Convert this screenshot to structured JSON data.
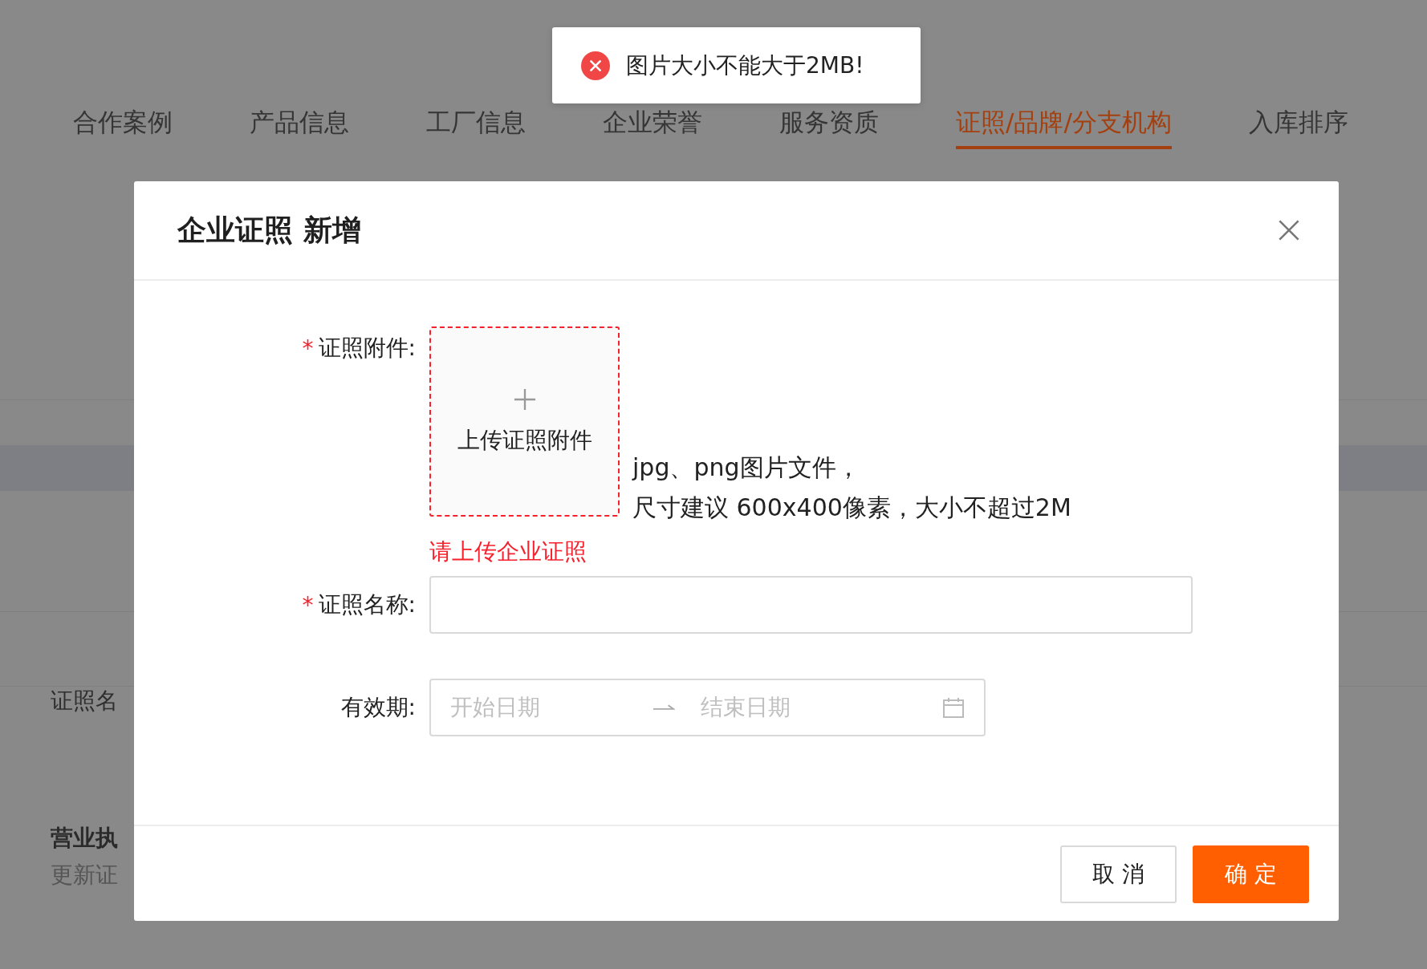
{
  "tabs": [
    {
      "label": "合作案例",
      "selected": false
    },
    {
      "label": "产品信息",
      "selected": false
    },
    {
      "label": "工厂信息",
      "selected": false
    },
    {
      "label": "企业荣誉",
      "selected": false
    },
    {
      "label": "服务资质",
      "selected": false
    },
    {
      "label": "证照/品牌/分支机构",
      "selected": true
    },
    {
      "label": "入库排序",
      "selected": false
    }
  ],
  "background_items": [
    {
      "kind": "label",
      "text": "证照名"
    },
    {
      "kind": "title",
      "text": "营业执"
    },
    {
      "kind": "sub",
      "text": "更新证"
    }
  ],
  "toast": {
    "kind": "error",
    "message": "图片大小不能大于2MB!"
  },
  "dialog": {
    "title": "企业证照 新增",
    "fields": [
      {
        "kind": "upload",
        "required_mark": "*",
        "label": "证照附件:",
        "button": "上传证照附件",
        "hints": [
          "jpg、png图片文件，",
          "尺寸建议 600x400像素，大小不超过2M"
        ],
        "error": "请上传企业证照"
      },
      {
        "kind": "text",
        "required_mark": "*",
        "label": "证照名称:"
      },
      {
        "kind": "daterange",
        "label": "有效期:",
        "start_placeholder": "开始日期",
        "end_placeholder": "结束日期"
      }
    ],
    "buttons": [
      {
        "kind": "default",
        "label": "取 消"
      },
      {
        "kind": "primary",
        "label": "确 定"
      }
    ]
  }
}
